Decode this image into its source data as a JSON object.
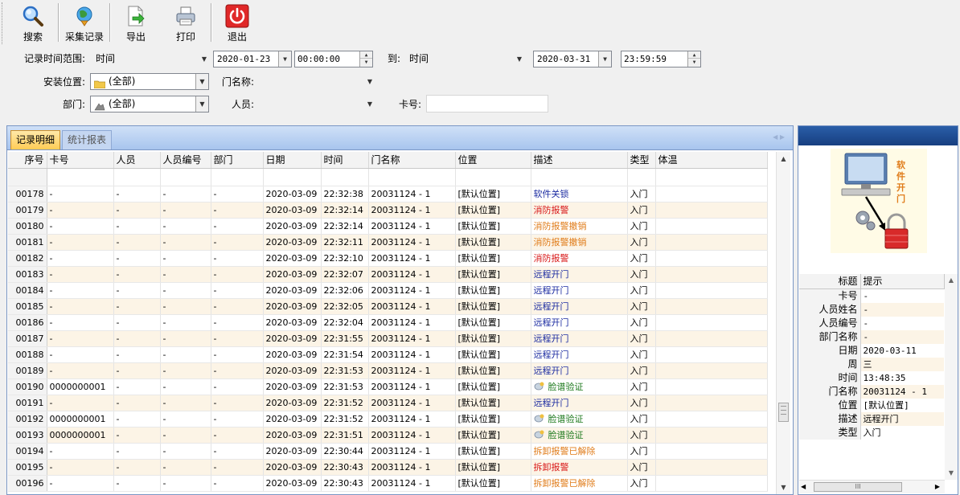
{
  "toolbar": {
    "search": "搜索",
    "collect": "采集记录",
    "export": "导出",
    "print": "打印",
    "exit": "退出"
  },
  "filters": {
    "time_range_label": "记录时间范围:",
    "time_type_from": "时间",
    "date_from": "2020-01-23",
    "time_from": "00:00:00",
    "to_label": "到:",
    "time_type_to": "时间",
    "date_to": "2020-03-31",
    "time_to": "23:59:59",
    "location_label": "安装位置:",
    "location_value": "(全部)",
    "door_label": "门名称:",
    "door_value": "",
    "department_label": "部门:",
    "department_value": "(全部)",
    "person_label": "人员:",
    "person_value": "",
    "card_label": "卡号:",
    "card_value": ""
  },
  "tabs": {
    "details": "记录明细",
    "report": "统计报表"
  },
  "grid": {
    "columns": [
      "序号",
      "卡号",
      "人员",
      "人员编号",
      "部门",
      "日期",
      "时间",
      "门名称",
      "位置",
      "描述",
      "类型",
      "体温"
    ],
    "rows": [
      {
        "seq": "00178",
        "card": "-",
        "person": "-",
        "person_no": "-",
        "dept": "-",
        "date": "2020-03-09",
        "time": "22:32:38",
        "door": "20031124 - 1",
        "location": "[默认位置]",
        "desc": "软件关锁",
        "desc_color": "blue",
        "type": "入门",
        "temp": ""
      },
      {
        "seq": "00179",
        "card": "-",
        "person": "-",
        "person_no": "-",
        "dept": "-",
        "date": "2020-03-09",
        "time": "22:32:14",
        "door": "20031124 - 1",
        "location": "[默认位置]",
        "desc": "消防报警",
        "desc_color": "red",
        "type": "入门",
        "temp": ""
      },
      {
        "seq": "00180",
        "card": "-",
        "person": "-",
        "person_no": "-",
        "dept": "-",
        "date": "2020-03-09",
        "time": "22:32:14",
        "door": "20031124 - 1",
        "location": "[默认位置]",
        "desc": "消防报警撤销",
        "desc_color": "orange",
        "type": "入门",
        "temp": ""
      },
      {
        "seq": "00181",
        "card": "-",
        "person": "-",
        "person_no": "-",
        "dept": "-",
        "date": "2020-03-09",
        "time": "22:32:11",
        "door": "20031124 - 1",
        "location": "[默认位置]",
        "desc": "消防报警撤销",
        "desc_color": "orange",
        "type": "入门",
        "temp": ""
      },
      {
        "seq": "00182",
        "card": "-",
        "person": "-",
        "person_no": "-",
        "dept": "-",
        "date": "2020-03-09",
        "time": "22:32:10",
        "door": "20031124 - 1",
        "location": "[默认位置]",
        "desc": "消防报警",
        "desc_color": "red",
        "type": "入门",
        "temp": ""
      },
      {
        "seq": "00183",
        "card": "-",
        "person": "-",
        "person_no": "-",
        "dept": "-",
        "date": "2020-03-09",
        "time": "22:32:07",
        "door": "20031124 - 1",
        "location": "[默认位置]",
        "desc": "远程开门",
        "desc_color": "blue",
        "type": "入门",
        "temp": ""
      },
      {
        "seq": "00184",
        "card": "-",
        "person": "-",
        "person_no": "-",
        "dept": "-",
        "date": "2020-03-09",
        "time": "22:32:06",
        "door": "20031124 - 1",
        "location": "[默认位置]",
        "desc": "远程开门",
        "desc_color": "blue",
        "type": "入门",
        "temp": ""
      },
      {
        "seq": "00185",
        "card": "-",
        "person": "-",
        "person_no": "-",
        "dept": "-",
        "date": "2020-03-09",
        "time": "22:32:05",
        "door": "20031124 - 1",
        "location": "[默认位置]",
        "desc": "远程开门",
        "desc_color": "blue",
        "type": "入门",
        "temp": ""
      },
      {
        "seq": "00186",
        "card": "-",
        "person": "-",
        "person_no": "-",
        "dept": "-",
        "date": "2020-03-09",
        "time": "22:32:04",
        "door": "20031124 - 1",
        "location": "[默认位置]",
        "desc": "远程开门",
        "desc_color": "blue",
        "type": "入门",
        "temp": ""
      },
      {
        "seq": "00187",
        "card": "-",
        "person": "-",
        "person_no": "-",
        "dept": "-",
        "date": "2020-03-09",
        "time": "22:31:55",
        "door": "20031124 - 1",
        "location": "[默认位置]",
        "desc": "远程开门",
        "desc_color": "blue",
        "type": "入门",
        "temp": ""
      },
      {
        "seq": "00188",
        "card": "-",
        "person": "-",
        "person_no": "-",
        "dept": "-",
        "date": "2020-03-09",
        "time": "22:31:54",
        "door": "20031124 - 1",
        "location": "[默认位置]",
        "desc": "远程开门",
        "desc_color": "blue",
        "type": "入门",
        "temp": ""
      },
      {
        "seq": "00189",
        "card": "-",
        "person": "-",
        "person_no": "-",
        "dept": "-",
        "date": "2020-03-09",
        "time": "22:31:53",
        "door": "20031124 - 1",
        "location": "[默认位置]",
        "desc": "远程开门",
        "desc_color": "blue",
        "type": "入门",
        "temp": ""
      },
      {
        "seq": "00190",
        "card": "0000000001",
        "person": "-",
        "person_no": "-",
        "dept": "-",
        "date": "2020-03-09",
        "time": "22:31:53",
        "door": "20031124 - 1",
        "location": "[默认位置]",
        "desc": "脸谱验证",
        "desc_color": "green",
        "face": true,
        "type": "入门",
        "temp": ""
      },
      {
        "seq": "00191",
        "card": "-",
        "person": "-",
        "person_no": "-",
        "dept": "-",
        "date": "2020-03-09",
        "time": "22:31:52",
        "door": "20031124 - 1",
        "location": "[默认位置]",
        "desc": "远程开门",
        "desc_color": "blue",
        "type": "入门",
        "temp": ""
      },
      {
        "seq": "00192",
        "card": "0000000001",
        "person": "-",
        "person_no": "-",
        "dept": "-",
        "date": "2020-03-09",
        "time": "22:31:52",
        "door": "20031124 - 1",
        "location": "[默认位置]",
        "desc": "脸谱验证",
        "desc_color": "green",
        "face": true,
        "type": "入门",
        "temp": ""
      },
      {
        "seq": "00193",
        "card": "0000000001",
        "person": "-",
        "person_no": "-",
        "dept": "-",
        "date": "2020-03-09",
        "time": "22:31:51",
        "door": "20031124 - 1",
        "location": "[默认位置]",
        "desc": "脸谱验证",
        "desc_color": "green",
        "face": true,
        "type": "入门",
        "temp": ""
      },
      {
        "seq": "00194",
        "card": "-",
        "person": "-",
        "person_no": "-",
        "dept": "-",
        "date": "2020-03-09",
        "time": "22:30:44",
        "door": "20031124 - 1",
        "location": "[默认位置]",
        "desc": "拆卸报警已解除",
        "desc_color": "orange",
        "type": "入门",
        "temp": ""
      },
      {
        "seq": "00195",
        "card": "-",
        "person": "-",
        "person_no": "-",
        "dept": "-",
        "date": "2020-03-09",
        "time": "22:30:43",
        "door": "20031124 - 1",
        "location": "[默认位置]",
        "desc": "拆卸报警",
        "desc_color": "red",
        "type": "入门",
        "temp": ""
      },
      {
        "seq": "00196",
        "card": "-",
        "person": "-",
        "person_no": "-",
        "dept": "-",
        "date": "2020-03-09",
        "time": "22:30:43",
        "door": "20031124 - 1",
        "location": "[默认位置]",
        "desc": "拆卸报警已解除",
        "desc_color": "orange",
        "type": "入门",
        "temp": ""
      }
    ]
  },
  "side": {
    "image_caption": "软件开门",
    "header": {
      "key": "标题",
      "value": "提示"
    },
    "details": [
      {
        "key": "卡号",
        "value": "-"
      },
      {
        "key": "人员姓名",
        "value": "-"
      },
      {
        "key": "人员编号",
        "value": "-"
      },
      {
        "key": "部门名称",
        "value": "-"
      },
      {
        "key": "日期",
        "value": "2020-03-11"
      },
      {
        "key": "周",
        "value": "三"
      },
      {
        "key": "时间",
        "value": "13:48:35"
      },
      {
        "key": "门名称",
        "value": "20031124 - 1"
      },
      {
        "key": "位置",
        "value": "[默认位置]"
      },
      {
        "key": "描述",
        "value": "远程开门"
      },
      {
        "key": "类型",
        "value": "入门"
      }
    ]
  },
  "colors": {
    "blue": "#1a2aa0",
    "red": "#d81818",
    "orange": "#e07c1a",
    "green": "#1e7a1e",
    "tab_active": "#ffcc55",
    "panel_border": "#7a96c4",
    "side_bar": "#1e4e95",
    "alt_row": "#fcf4e6"
  },
  "icons": {
    "search": "magnifier-icon",
    "collect": "globe-download-icon",
    "export": "export-document-icon",
    "print": "printer-icon",
    "exit": "power-icon"
  }
}
